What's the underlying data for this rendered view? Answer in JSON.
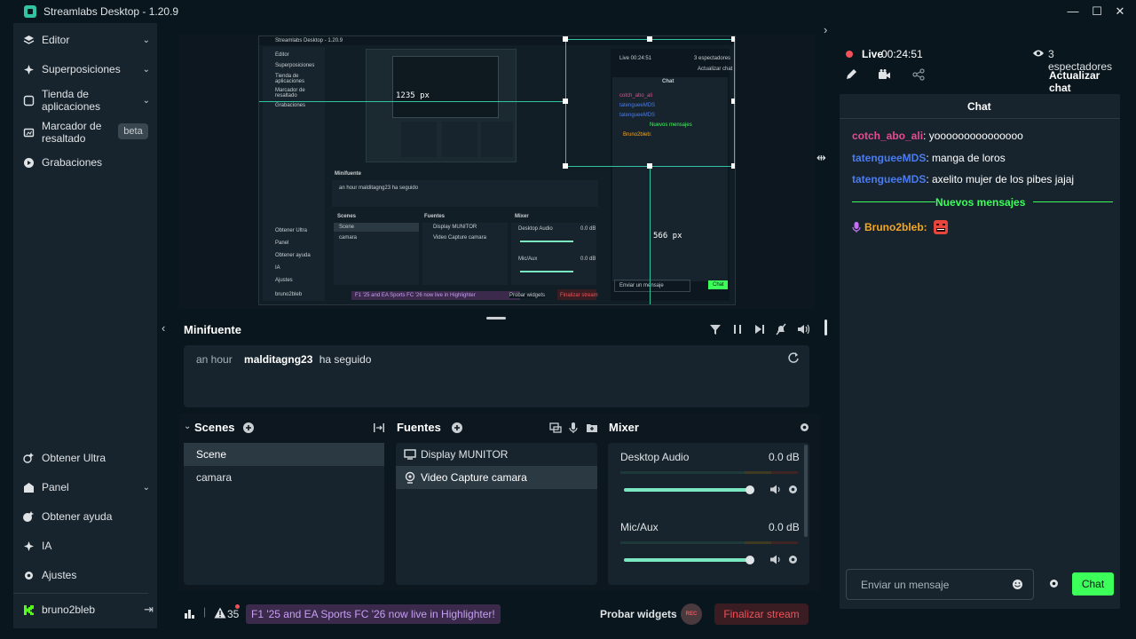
{
  "window": {
    "title": "Streamlabs Desktop - 1.20.9",
    "controls": {
      "minimize": "—",
      "maximize": "☐",
      "close": "✕"
    }
  },
  "sidebar": {
    "items": [
      {
        "label": "Editor",
        "icon": "layers-icon"
      },
      {
        "label": "Superposiciones",
        "icon": "overlays-icon"
      },
      {
        "label": "Tienda de aplicaciones",
        "icon": "store-icon"
      },
      {
        "label": "Marcador de resaltado",
        "icon": "highlighter-icon",
        "badge": "beta"
      },
      {
        "label": "Grabaciones",
        "icon": "recordings-icon"
      }
    ],
    "bottom_items": [
      {
        "label": "Obtener Ultra",
        "icon": "ultra-icon"
      },
      {
        "label": "Panel",
        "icon": "dashboard-icon"
      },
      {
        "label": "Obtener ayuda",
        "icon": "help-icon"
      },
      {
        "label": "IA",
        "icon": "ai-sparkle-icon"
      },
      {
        "label": "Ajustes",
        "icon": "settings-icon"
      }
    ],
    "user": {
      "name": "bruno2bleb",
      "logout_icon": "logout-icon"
    }
  },
  "preview": {
    "measure_width": "1235 px",
    "measure_height": "566 px",
    "mini": {
      "title": "Streamlabs Desktop - 1.20.9",
      "live": "Live 00:24:51",
      "viewers": "3 espectadores",
      "refresh": "Actualizar chat",
      "chat": "Chat",
      "new_messages": "Nuevos mensajes",
      "input": "Enviar un mensaje",
      "send": "Chat",
      "minifuente": "Minifuente",
      "follow": "an hour  malditagng23  ha seguido",
      "scenes": "Scenes",
      "fuentes": "Fuentes",
      "mixer": "Mixer",
      "scene1": "Scene",
      "scene2": "camara",
      "src1": "Display MUNITOR",
      "src2": "Video Capture camara",
      "audio1": "Desktop Audio",
      "audio2": "Mic/Aux",
      "db": "0.0 dB",
      "banner": "F1 '25 and EA Sports FC '26 now live in Highlighter",
      "probar": "Probar widgets",
      "finalizar": "Finalizar stream",
      "sidebar": [
        "Editor",
        "Superposiciones",
        "Tienda de aplicaciones",
        "Marcador de resaltado",
        "Grabaciones"
      ],
      "sidebar_bottom": [
        "Obtener Ultra",
        "Panel",
        "Obtener ayuda",
        "IA",
        "Ajustes",
        "bruno2bleb"
      ]
    }
  },
  "minifuente": {
    "title": "Minifuente",
    "event": {
      "time": "an hour",
      "user": "malditagng23",
      "action": "ha seguido"
    }
  },
  "scenes": {
    "title": "Scenes",
    "items": [
      "Scene",
      "camara"
    ],
    "selected": "Scene"
  },
  "fuentes": {
    "title": "Fuentes",
    "items": [
      {
        "label": "Display MUNITOR",
        "icon": "monitor-icon"
      },
      {
        "label": "Video Capture camara",
        "icon": "camera-icon"
      }
    ]
  },
  "mixer": {
    "title": "Mixer",
    "channels": [
      {
        "name": "Desktop Audio",
        "level": "0.0 dB",
        "volume": 1.0
      },
      {
        "name": "Mic/Aux",
        "level": "0.0 dB",
        "volume": 1.0
      }
    ]
  },
  "statusbar": {
    "alerts_count": "35",
    "highlighter_msg": "F1 '25 and EA Sports FC '26 now live in Highlighter!",
    "test_widgets": "Probar widgets",
    "rec": "REC",
    "end_stream": "Finalizar stream"
  },
  "live": {
    "status": "Live",
    "timer": "00:24:51",
    "viewers": "3 espectadores",
    "refresh_chat": "Actualizar chat"
  },
  "chat": {
    "title": "Chat",
    "messages": [
      {
        "user": "cotch_abo_ali",
        "text": ": yooooooooooooooo",
        "color": "#e44d90"
      },
      {
        "user": "tatengueeMDS",
        "text": ": manga de loros",
        "color": "#4a7cf1"
      },
      {
        "user": "tatengueeMDS",
        "text": ": axelito mujer de los pibes jajaj",
        "color": "#4a7cf1"
      }
    ],
    "new_messages_divider": "Nuevos mensajes",
    "last_message": {
      "user": "Bruno2bleb:",
      "color": "#f5a623"
    },
    "input_placeholder": "Enviar un mensaje",
    "send_label": "Chat"
  },
  "colors": {
    "accent": "#31c3a2",
    "live_red": "#f25159",
    "chat_green": "#3cff5a"
  }
}
